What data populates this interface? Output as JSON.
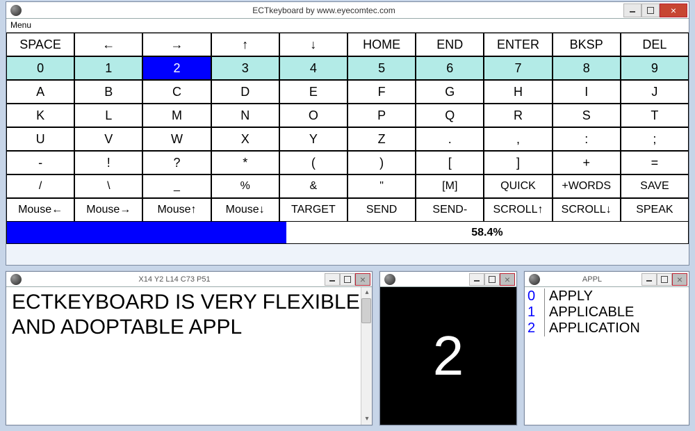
{
  "main_window": {
    "title": "ECTkeyboard by www.eyecomtec.com",
    "menu_label": "Menu",
    "rows": [
      {
        "kind": "special",
        "cells": [
          "SPACE",
          "←",
          "→",
          "↑",
          "↓",
          "HOME",
          "END",
          "ENTER",
          "BKSP",
          "DEL"
        ]
      },
      {
        "kind": "digits",
        "cells": [
          "0",
          "1",
          "2",
          "3",
          "4",
          "5",
          "6",
          "7",
          "8",
          "9"
        ],
        "selected_col": 2
      },
      {
        "kind": "letters",
        "cells": [
          "A",
          "B",
          "C",
          "D",
          "E",
          "F",
          "G",
          "H",
          "I",
          "J"
        ]
      },
      {
        "kind": "letters",
        "cells": [
          "K",
          "L",
          "M",
          "N",
          "O",
          "P",
          "Q",
          "R",
          "S",
          "T"
        ]
      },
      {
        "kind": "letters",
        "cells": [
          "U",
          "V",
          "W",
          "X",
          "Y",
          "Z",
          ".",
          ",",
          ":",
          ";"
        ]
      },
      {
        "kind": "punct",
        "cells": [
          "-",
          "!",
          "?",
          "*",
          "(",
          ")",
          "[",
          "]",
          "+",
          "="
        ]
      },
      {
        "kind": "cmds",
        "cells": [
          "/",
          "\\",
          "_",
          "%",
          "&",
          "\"",
          "[M]",
          "QUICK",
          "+WORDS",
          "SAVE"
        ]
      },
      {
        "kind": "cmds",
        "cells": [
          "Mouse←",
          "Mouse→",
          "Mouse↑",
          "Mouse↓",
          "TARGET",
          "SEND",
          "SEND-",
          "SCROLL↑",
          "SCROLL↓",
          "SPEAK"
        ]
      }
    ],
    "progress_percent": 58.4,
    "progress_label": "58.4%"
  },
  "text_panel": {
    "title": "X14  Y2  L14  C73  P51",
    "text": "ECTKEYBOARD IS VERY FLEXIBLE AND ADOPTABLE APPL"
  },
  "display_panel": {
    "title": "",
    "big_char": "2"
  },
  "suggestions_panel": {
    "title": "APPL",
    "items": [
      {
        "idx": "0",
        "word": "APPLY"
      },
      {
        "idx": "1",
        "word": "APPLICABLE"
      },
      {
        "idx": "2",
        "word": "APPLICATION"
      }
    ]
  }
}
